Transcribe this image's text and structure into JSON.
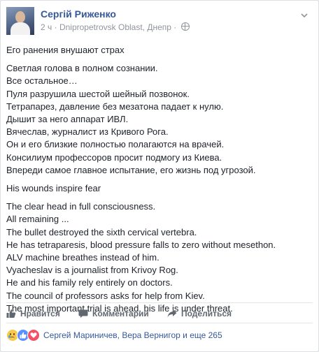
{
  "post": {
    "author": "Сергій Риженко",
    "time": "2 ч",
    "location": "Dnipropetrovsk Oblast, Днепр",
    "separator": "·"
  },
  "content": {
    "ru_title": "Его ранения внушают страх",
    "ru_lines": [
      "Светлая голова в полном сознании.",
      "Все остальное…",
      "Пуля разрушила шестой шейный позвонок.",
      "Тетрапарез, давление без мезатона падает к нулю.",
      "Дышит за него аппарат ИВЛ.",
      "Вячеслав, журналист из Кривого Рога.",
      "Он и его близкие полностью полагаются на врачей.",
      "Консилиум профессоров просит подмогу из Киева.",
      "Впереди самое главное испытание, его жизнь под угрозой."
    ],
    "en_title": "His wounds inspire fear",
    "en_lines": [
      "The clear head in full consciousness.",
      "All remaining ...",
      "The bullet destroyed the sixth cervical vertebra.",
      "He has tetraparesis, blood pressure falls to zero without mesethon.",
      "ALV machine breathes instead of him.",
      "Vyacheslav is a journalist from Krivoy Rog.",
      "He and his family rely entirely on doctors.",
      "The council of professors asks for help from Kiev.",
      "The most important trial is ahead, his life is under threat."
    ]
  },
  "actions": {
    "like": "Нравится",
    "comment": "Комментарий",
    "share": "Поделиться"
  },
  "reactions": {
    "types": [
      "sad",
      "like",
      "love"
    ],
    "names": "Сергей Мариничев, Вера Вернигор и еще 265"
  },
  "colors": {
    "link": "#365899",
    "meta": "#90949c",
    "text": "#1d2129",
    "action": "#606770"
  }
}
